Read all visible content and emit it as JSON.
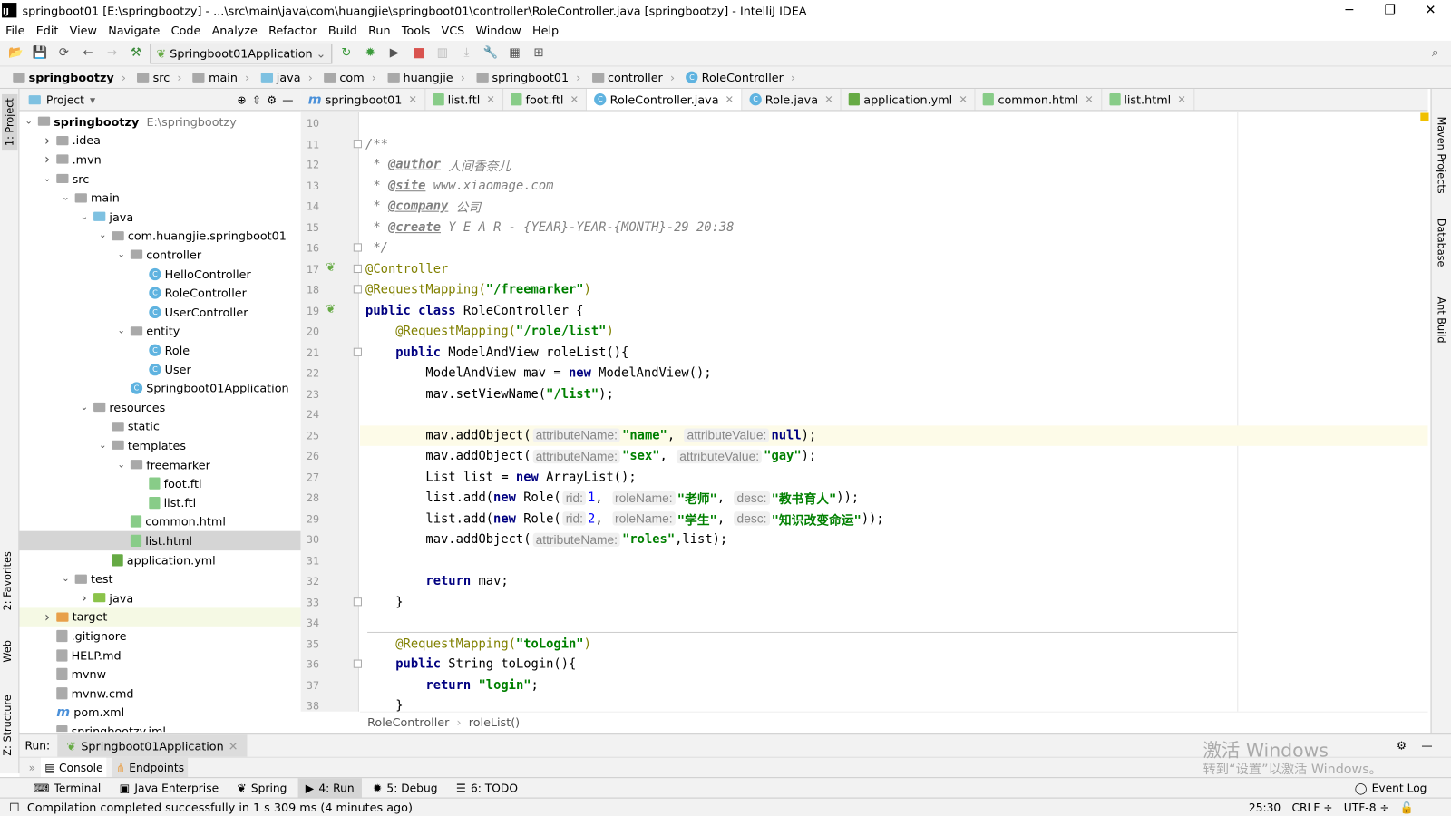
{
  "window": {
    "title": "springboot01 [E:\\springbootzy] - ...\\src\\main\\java\\com\\huangjie\\springboot01\\controller\\RoleController.java [springbootzy] - IntelliJ IDEA",
    "minimize": "─",
    "maximize": "❐",
    "close": "✕"
  },
  "menu": [
    "File",
    "Edit",
    "View",
    "Navigate",
    "Code",
    "Analyze",
    "Refactor",
    "Build",
    "Run",
    "Tools",
    "VCS",
    "Window",
    "Help"
  ],
  "toolbar": {
    "run_config": "Springboot01Application"
  },
  "breadcrumbs": [
    "springbootzy",
    "src",
    "main",
    "java",
    "com",
    "huangjie",
    "springboot01",
    "controller",
    "RoleController"
  ],
  "project": {
    "header": "Project",
    "tree": [
      {
        "label": "springbootzy",
        "extra": "E:\\springbootzy",
        "level": 0,
        "arrow": "open",
        "icon": "module"
      },
      {
        "label": ".idea",
        "level": 1,
        "arrow": "closed",
        "icon": "folder"
      },
      {
        "label": ".mvn",
        "level": 1,
        "arrow": "closed",
        "icon": "folder"
      },
      {
        "label": "src",
        "level": 1,
        "arrow": "open",
        "icon": "folder"
      },
      {
        "label": "main",
        "level": 2,
        "arrow": "open",
        "icon": "folder"
      },
      {
        "label": "java",
        "level": 3,
        "arrow": "open",
        "icon": "folder-blue"
      },
      {
        "label": "com.huangjie.springboot01",
        "level": 4,
        "arrow": "open",
        "icon": "package"
      },
      {
        "label": "controller",
        "level": 5,
        "arrow": "open",
        "icon": "package"
      },
      {
        "label": "HelloController",
        "level": 6,
        "arrow": "",
        "icon": "class"
      },
      {
        "label": "RoleController",
        "level": 6,
        "arrow": "",
        "icon": "class"
      },
      {
        "label": "UserController",
        "level": 6,
        "arrow": "",
        "icon": "class"
      },
      {
        "label": "entity",
        "level": 5,
        "arrow": "open",
        "icon": "package"
      },
      {
        "label": "Role",
        "level": 6,
        "arrow": "",
        "icon": "class"
      },
      {
        "label": "User",
        "level": 6,
        "arrow": "",
        "icon": "class"
      },
      {
        "label": "Springboot01Application",
        "level": 5,
        "arrow": "",
        "icon": "spring-class"
      },
      {
        "label": "resources",
        "level": 3,
        "arrow": "open",
        "icon": "folder-res"
      },
      {
        "label": "static",
        "level": 4,
        "arrow": "",
        "icon": "folder"
      },
      {
        "label": "templates",
        "level": 4,
        "arrow": "open",
        "icon": "folder"
      },
      {
        "label": "freemarker",
        "level": 5,
        "arrow": "open",
        "icon": "folder"
      },
      {
        "label": "foot.ftl",
        "level": 6,
        "arrow": "",
        "icon": "ftl"
      },
      {
        "label": "list.ftl",
        "level": 6,
        "arrow": "",
        "icon": "ftl"
      },
      {
        "label": "common.html",
        "level": 5,
        "arrow": "",
        "icon": "html"
      },
      {
        "label": "list.html",
        "level": 5,
        "arrow": "",
        "icon": "html",
        "selected": true
      },
      {
        "label": "application.yml",
        "level": 4,
        "arrow": "",
        "icon": "yml"
      },
      {
        "label": "test",
        "level": 2,
        "arrow": "open",
        "icon": "folder"
      },
      {
        "label": "java",
        "level": 3,
        "arrow": "closed",
        "icon": "folder-green"
      },
      {
        "label": "target",
        "level": 1,
        "arrow": "closed",
        "icon": "folder-orange",
        "highlight": true
      },
      {
        "label": ".gitignore",
        "level": 1,
        "arrow": "",
        "icon": "file"
      },
      {
        "label": "HELP.md",
        "level": 1,
        "arrow": "",
        "icon": "md"
      },
      {
        "label": "mvnw",
        "level": 1,
        "arrow": "",
        "icon": "file"
      },
      {
        "label": "mvnw.cmd",
        "level": 1,
        "arrow": "",
        "icon": "file"
      },
      {
        "label": "pom.xml",
        "level": 1,
        "arrow": "",
        "icon": "maven"
      },
      {
        "label": "springbootzy.iml",
        "level": 1,
        "arrow": "",
        "icon": "file"
      }
    ]
  },
  "left_tools": [
    "1: Project",
    "2: Favorites",
    "Web",
    "Z: Structure"
  ],
  "right_tools": [
    "Maven Projects",
    "Database",
    "Ant Build"
  ],
  "tabs": [
    {
      "label": "springboot01",
      "icon": "maven"
    },
    {
      "label": "list.ftl",
      "icon": "ftl"
    },
    {
      "label": "foot.ftl",
      "icon": "ftl"
    },
    {
      "label": "RoleController.java",
      "icon": "class",
      "active": true
    },
    {
      "label": "Role.java",
      "icon": "class"
    },
    {
      "label": "application.yml",
      "icon": "yml"
    },
    {
      "label": "common.html",
      "icon": "html"
    },
    {
      "label": "list.html",
      "icon": "html"
    }
  ],
  "editor": {
    "first_line": 10,
    "current_line": 25,
    "lines": [
      [],
      [
        [
          "c",
          "/**"
        ]
      ],
      [
        [
          "c",
          " * "
        ],
        [
          "t",
          "@author"
        ],
        [
          "c",
          " 人间香奈儿"
        ]
      ],
      [
        [
          "c",
          " * "
        ],
        [
          "t",
          "@site"
        ],
        [
          "c",
          " www.xiaomage.com"
        ]
      ],
      [
        [
          "c",
          " * "
        ],
        [
          "t",
          "@company"
        ],
        [
          "c",
          " 公司"
        ]
      ],
      [
        [
          "c",
          " * "
        ],
        [
          "t",
          "@create"
        ],
        [
          "c",
          " Y E A R - {YEAR}-YEAR-{MONTH}-29 20:38"
        ]
      ],
      [
        [
          "c",
          " */"
        ]
      ],
      [
        [
          "a",
          "@Controller"
        ]
      ],
      [
        [
          "a",
          "@RequestMapping("
        ],
        [
          "s",
          "\"/freemarker\""
        ],
        [
          "a",
          ")"
        ]
      ],
      [
        [
          "k",
          "public class "
        ],
        [
          "p",
          "RoleController {"
        ]
      ],
      [
        [
          "p",
          "    "
        ],
        [
          "a",
          "@RequestMapping("
        ],
        [
          "s",
          "\"/role/list\""
        ],
        [
          "a",
          ")"
        ]
      ],
      [
        [
          "p",
          "    "
        ],
        [
          "k",
          "public "
        ],
        [
          "p",
          "ModelAndView roleList(){"
        ]
      ],
      [
        [
          "p",
          "        ModelAndView mav = "
        ],
        [
          "k",
          "new "
        ],
        [
          "p",
          "ModelAndView();"
        ]
      ],
      [
        [
          "p",
          "        mav.setViewName("
        ],
        [
          "s",
          "\"/list\""
        ],
        [
          "p",
          ");"
        ]
      ],
      [],
      [
        [
          "p",
          "        mav.addObject("
        ],
        [
          "h",
          "attributeName:"
        ],
        [
          "s",
          "\"name\""
        ],
        [
          "p",
          ", "
        ],
        [
          "h",
          "attributeValue:"
        ],
        [
          "k",
          "null"
        ],
        [
          "p",
          ");"
        ]
      ],
      [
        [
          "p",
          "        mav.addObject("
        ],
        [
          "h",
          "attributeName:"
        ],
        [
          "s",
          "\"sex\""
        ],
        [
          "p",
          ", "
        ],
        [
          "h",
          "attributeValue:"
        ],
        [
          "s",
          "\"gay\""
        ],
        [
          "p",
          ");"
        ]
      ],
      [
        [
          "p",
          "        List list = "
        ],
        [
          "k",
          "new "
        ],
        [
          "p",
          "ArrayList();"
        ]
      ],
      [
        [
          "p",
          "        list.add("
        ],
        [
          "k",
          "new "
        ],
        [
          "p",
          "Role("
        ],
        [
          "h",
          "rid:"
        ],
        [
          "n",
          "1"
        ],
        [
          "p",
          ", "
        ],
        [
          "h",
          "roleName:"
        ],
        [
          "s",
          "\"老师\""
        ],
        [
          "p",
          ", "
        ],
        [
          "h",
          "desc:"
        ],
        [
          "s",
          "\"教书育人\""
        ],
        [
          "p",
          "));"
        ]
      ],
      [
        [
          "p",
          "        list.add("
        ],
        [
          "k",
          "new "
        ],
        [
          "p",
          "Role("
        ],
        [
          "h",
          "rid:"
        ],
        [
          "n",
          "2"
        ],
        [
          "p",
          ", "
        ],
        [
          "h",
          "roleName:"
        ],
        [
          "s",
          "\"学生\""
        ],
        [
          "p",
          ", "
        ],
        [
          "h",
          "desc:"
        ],
        [
          "s",
          "\"知识改变命运\""
        ],
        [
          "p",
          "));"
        ]
      ],
      [
        [
          "p",
          "        mav.addObject("
        ],
        [
          "h",
          "attributeName:"
        ],
        [
          "s",
          "\"roles\""
        ],
        [
          "p",
          ",list);"
        ]
      ],
      [],
      [
        [
          "p",
          "        "
        ],
        [
          "k",
          "return "
        ],
        [
          "p",
          "mav;"
        ]
      ],
      [
        [
          "p",
          "    }"
        ]
      ],
      [],
      [
        [
          "p",
          "    "
        ],
        [
          "a",
          "@RequestMapping("
        ],
        [
          "s",
          "\"toLogin\""
        ],
        [
          "a",
          ")"
        ]
      ],
      [
        [
          "p",
          "    "
        ],
        [
          "k",
          "public "
        ],
        [
          "p",
          "String toLogin(){"
        ]
      ],
      [
        [
          "p",
          "        "
        ],
        [
          "k",
          "return "
        ],
        [
          "s",
          "\"login\""
        ],
        [
          "p",
          ";"
        ]
      ],
      [
        [
          "p",
          "    }"
        ]
      ]
    ]
  },
  "editor_breadcrumb": [
    "RoleController",
    "roleList()"
  ],
  "run": {
    "label": "Run:",
    "config": "Springboot01Application",
    "tabs": [
      "Console",
      "Endpoints"
    ]
  },
  "bottom_tools": [
    {
      "label": "Terminal"
    },
    {
      "label": "Java Enterprise"
    },
    {
      "label": "Spring"
    },
    {
      "label": "4: Run",
      "active": true
    },
    {
      "label": "5: Debug"
    },
    {
      "label": "6: TODO"
    }
  ],
  "event_log": "Event Log",
  "status": {
    "message": "Compilation completed successfully in 1 s 309 ms (4 minutes ago)",
    "position": "25:30",
    "line_sep": "CRLF ÷",
    "encoding": "UTF-8 ÷"
  },
  "watermark": {
    "line1": "激活 Windows",
    "line2": "转到“设置”以激活 Windows。"
  }
}
